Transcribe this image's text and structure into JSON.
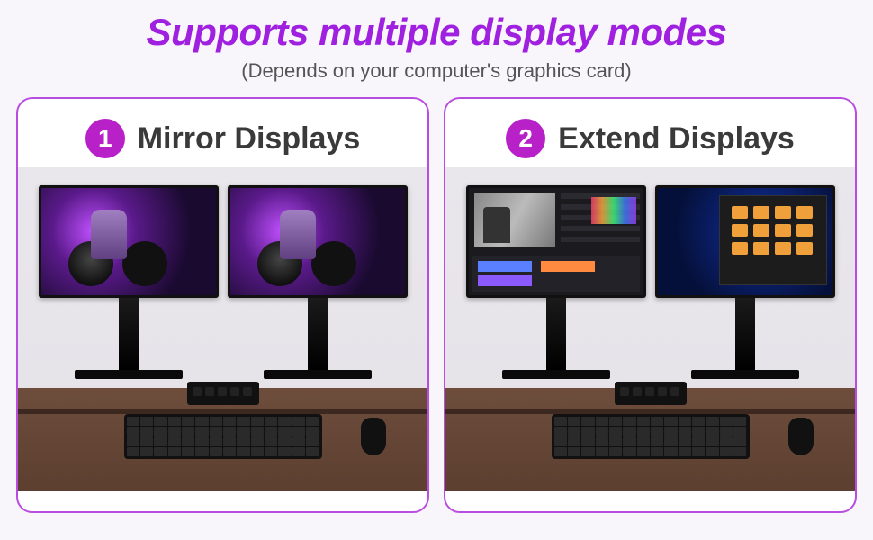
{
  "header": {
    "title": "Supports multiple display modes",
    "subtitle": "(Depends on your computer's graphics card)"
  },
  "panels": [
    {
      "num": "1",
      "label": "Mirror Displays"
    },
    {
      "num": "2",
      "label": "Extend Displays"
    }
  ]
}
